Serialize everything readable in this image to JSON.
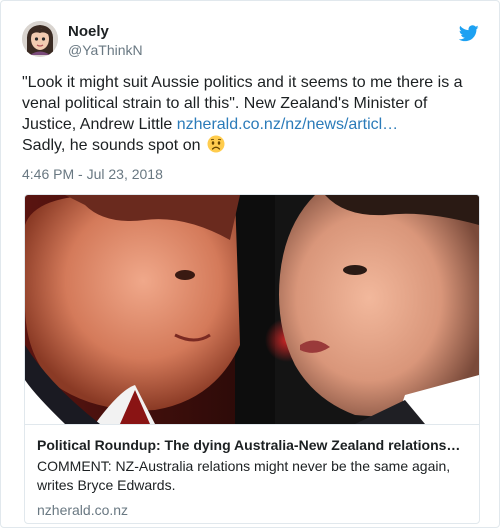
{
  "tweet": {
    "display_name": "Noely",
    "handle": "@YaThinkN",
    "text_line_1": "\"Look it might suit Aussie politics and it seems to me there is a venal political strain to all this\". New Zealand's Minister of Justice, Andrew Little ",
    "link_text": "nzherald.co.nz/nz/news/articl…",
    "text_line_2": "Sadly, he sounds spot on ",
    "emoji": "worried-face-emoji",
    "timestamp": "4:46 PM - Jul 23, 2018"
  },
  "card": {
    "title": "Political Roundup: The dying Australia-New Zealand relations…",
    "description": "COMMENT: NZ-Australia relations might never be the same again, writes Bryce Edwards.",
    "domain": "nzherald.co.nz"
  },
  "icons": {
    "brand": "twitter-bird-icon"
  },
  "colors": {
    "link": "#2b7bb9",
    "twitter_blue": "#1da1f2",
    "muted_text": "#697882",
    "border": "#e1e8ed"
  }
}
